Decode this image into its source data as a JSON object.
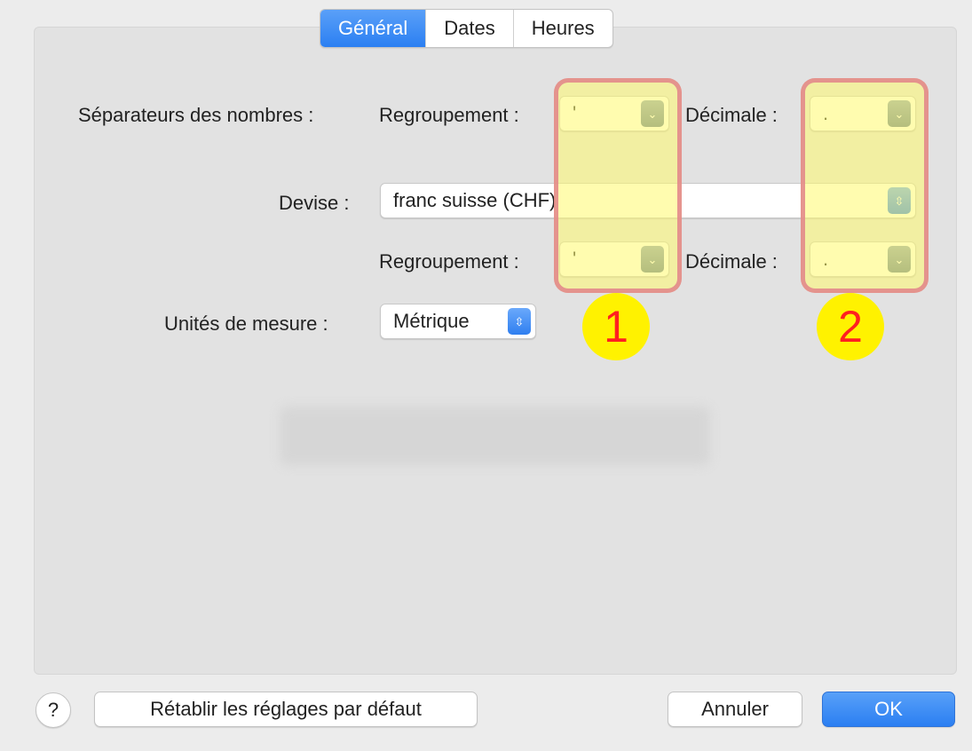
{
  "tabs": [
    {
      "label": "Général",
      "active": true
    },
    {
      "label": "Dates",
      "active": false
    },
    {
      "label": "Heures",
      "active": false
    }
  ],
  "numbers": {
    "label": "Séparateurs des nombres :",
    "grouping_label": "Regroupement :",
    "grouping_value": "'",
    "decimal_label": "Décimale :",
    "decimal_value": "."
  },
  "currency": {
    "label": "Devise :",
    "value": "franc suisse (CHF)",
    "grouping_label": "Regroupement :",
    "grouping_value": "'",
    "decimal_label": "Décimale :",
    "decimal_value": "."
  },
  "units": {
    "label": "Unités de mesure :",
    "value": "Métrique"
  },
  "annotations": {
    "marker_1": "1",
    "marker_2": "2",
    "highlight_color": "#fff86e",
    "border_color": "#e2848a",
    "circle_color": "#fff200",
    "circle_text_color": "#ff2020"
  },
  "footer": {
    "help_label": "?",
    "reset_label": "Rétablir les réglages par défaut",
    "cancel_label": "Annuler",
    "ok_label": "OK"
  },
  "accent_color": "#2b7ff2"
}
